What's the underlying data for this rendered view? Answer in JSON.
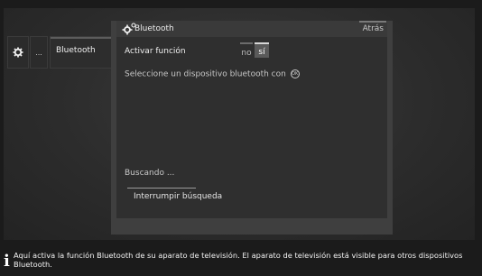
{
  "sidebar": {
    "gear_icon": "gear-icon",
    "more_label": "...",
    "item_label": "Bluetooth"
  },
  "panel": {
    "title": "Bluetooth",
    "title_icon": "bluetooth-settings-icon",
    "back_label": "Atrás",
    "activate_label": "Activar función",
    "toggle_off": "no",
    "toggle_on": "sí",
    "toggle_selected": "sí",
    "hint_text": "Seleccione un dispositivo bluetooth con",
    "hint_icon": "ok-button-icon",
    "hint_icon_label": "OK",
    "searching_text": "Buscando ...",
    "stop_search_label": "Interrumpir búsqueda"
  },
  "info_bar": {
    "icon": "info-icon",
    "icon_glyph": "i",
    "text": "Aquí activa la función Bluetooth de su aparato de televisión. El aparato de televisión está visible para otros dispositivos Bluetooth."
  },
  "colors": {
    "background": "#1b1b1b",
    "panel": "#2f2f2f",
    "toggle_selected": "#5a5a5a"
  }
}
